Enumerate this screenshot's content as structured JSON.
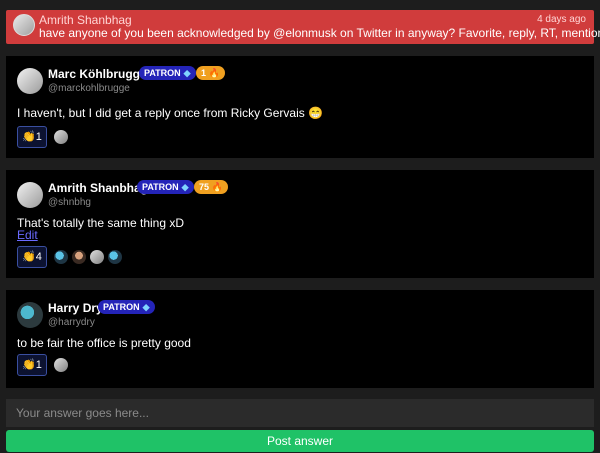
{
  "question": {
    "author": "Amrith Shanbhag",
    "time": "4 days ago",
    "text": "have anyone of you been acknowledged by @elonmusk on Twitter in anyway? Favorite, reply, RT, mention?"
  },
  "answers": [
    {
      "name": "Marc Köhlbrugge",
      "handle": "@marckohlbrugge",
      "patron": "PATRON",
      "streak": "1",
      "text": "I haven't, but I did get a reply once from Ricky Gervais 😁",
      "claps": "1"
    },
    {
      "name": "Amrith Shanbhag",
      "handle": "@shnbhg",
      "patron": "PATRON",
      "streak": "75",
      "text": "That's totally the same thing xD",
      "edit": "Edit",
      "claps": "4"
    },
    {
      "name": "Harry Dry",
      "handle": "@harrydry",
      "patron": "PATRON",
      "text": "to be fair the office is pretty good",
      "claps": "1"
    }
  ],
  "form": {
    "placeholder": "Your answer goes here...",
    "submit_label": "Post answer"
  },
  "colors": {
    "question_bg": "#d03c3c",
    "patron_badge": "#2424b8",
    "streak_badge": "#f0a020",
    "post_button": "#1fc267"
  }
}
